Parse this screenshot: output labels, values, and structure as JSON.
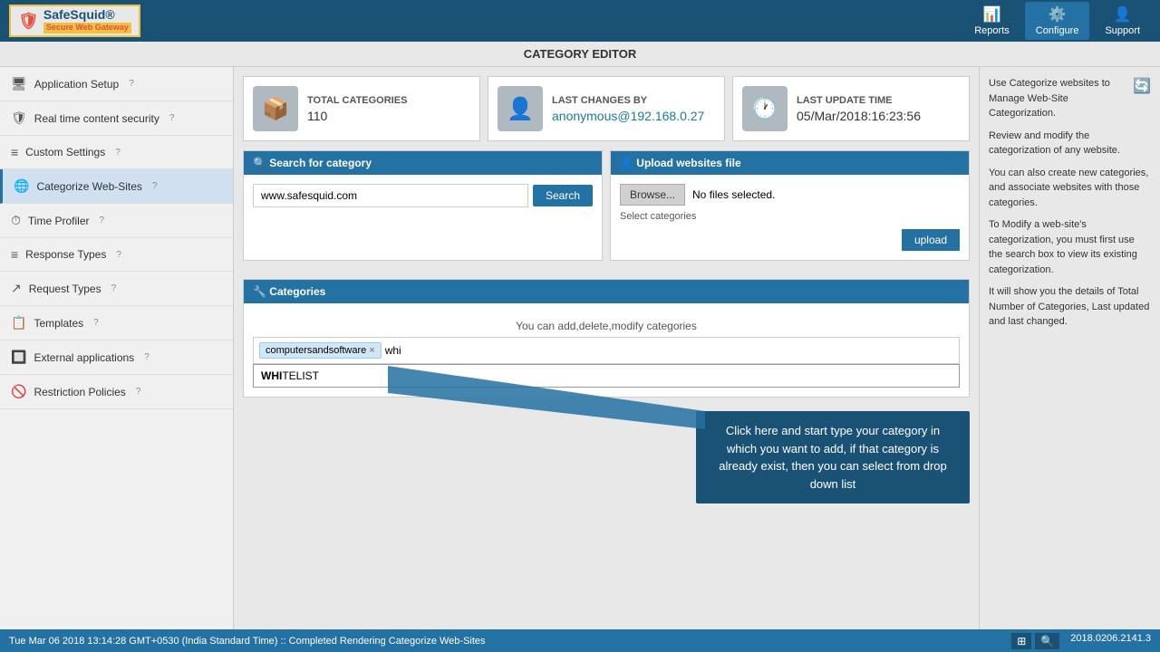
{
  "topnav": {
    "logo_name": "SafeSquid®",
    "logo_tagline": "Secure Web Gateway",
    "nav_items": [
      {
        "id": "reports",
        "label": "Reports",
        "icon": "📊"
      },
      {
        "id": "configure",
        "label": "Configure",
        "icon": "⚙️"
      },
      {
        "id": "support",
        "label": "Support",
        "icon": "👤"
      }
    ]
  },
  "page_title": "CATEGORY EDITOR",
  "stats": [
    {
      "id": "total-categories",
      "icon": "📦",
      "label": "TOTAL CATEGORIES",
      "value": "110"
    },
    {
      "id": "last-changes-by",
      "icon": "👤",
      "label": "LAST CHANGES BY",
      "value": "anonymous@192.168.0.27",
      "highlight": true
    },
    {
      "id": "last-update-time",
      "icon": "🕐",
      "label": "LAST UPDATE TIME",
      "value": "05/Mar/2018:16:23:56",
      "highlight": false
    }
  ],
  "search_section": {
    "header": "🔍 Search for category",
    "input_value": "www.safesquid.com",
    "button_label": "Search"
  },
  "upload_section": {
    "header": "👤 Upload websites file",
    "browse_label": "Browse...",
    "no_file_text": "No files selected.",
    "select_label": "Select categories",
    "upload_label": "upload"
  },
  "categories_section": {
    "header": "🔧 Categories",
    "hint": "You can add,delete,modify categories",
    "tags": [
      {
        "id": "tag-computersandsoftware",
        "label": "computersandsoftware"
      }
    ],
    "input_value": "whi",
    "dropdown_items": [
      {
        "id": "whitelist",
        "match": "WHI",
        "rest": "TELIST"
      }
    ]
  },
  "right_info": {
    "lines": [
      "Use Categorize websites to Manage Web-Site Categorization.",
      "Review and modify the categorization of any website.",
      "You can also create new categories, and associate websites with those categories.",
      "To Modify a web-site's categorization, you must first use the search box to view its existing categorization.",
      "It will show you the details of Total Number of Categories, Last updated and last changed."
    ]
  },
  "sidebar": {
    "items": [
      {
        "id": "application-setup",
        "label": "Application Setup",
        "icon": "🖥",
        "help": "?"
      },
      {
        "id": "real-time-content",
        "label": "Real time content security",
        "icon": "🛡",
        "help": "?"
      },
      {
        "id": "custom-settings",
        "label": "Custom Settings",
        "icon": "≡",
        "help": "?"
      },
      {
        "id": "categorize-web-sites",
        "label": "Categorize Web-Sites",
        "icon": "🌐",
        "help": "?",
        "active": true
      },
      {
        "id": "time-profiler",
        "label": "Time Profiler",
        "icon": "⏱",
        "help": "?"
      },
      {
        "id": "response-types",
        "label": "Response Types",
        "icon": "≡",
        "help": "?"
      },
      {
        "id": "request-types",
        "label": "Request Types",
        "icon": "↗",
        "help": "?"
      },
      {
        "id": "templates",
        "label": "Templates",
        "icon": "📋",
        "help": "?"
      },
      {
        "id": "external-applications",
        "label": "External applications",
        "icon": "🔲",
        "help": "?"
      },
      {
        "id": "restriction-policies",
        "label": "Restriction Policies",
        "icon": "🚫",
        "help": "?"
      }
    ]
  },
  "annotation": {
    "tooltip_text": "Click here and start type your category in which you want to add, if that category is already exist, then you can select from drop down list"
  },
  "status_bar": {
    "left_text": "Tue Mar 06 2018 13:14:28 GMT+0530 (India Standard Time) :: Completed Rendering Categorize Web-Sites",
    "right_text": "2018.0206.2141.3"
  }
}
